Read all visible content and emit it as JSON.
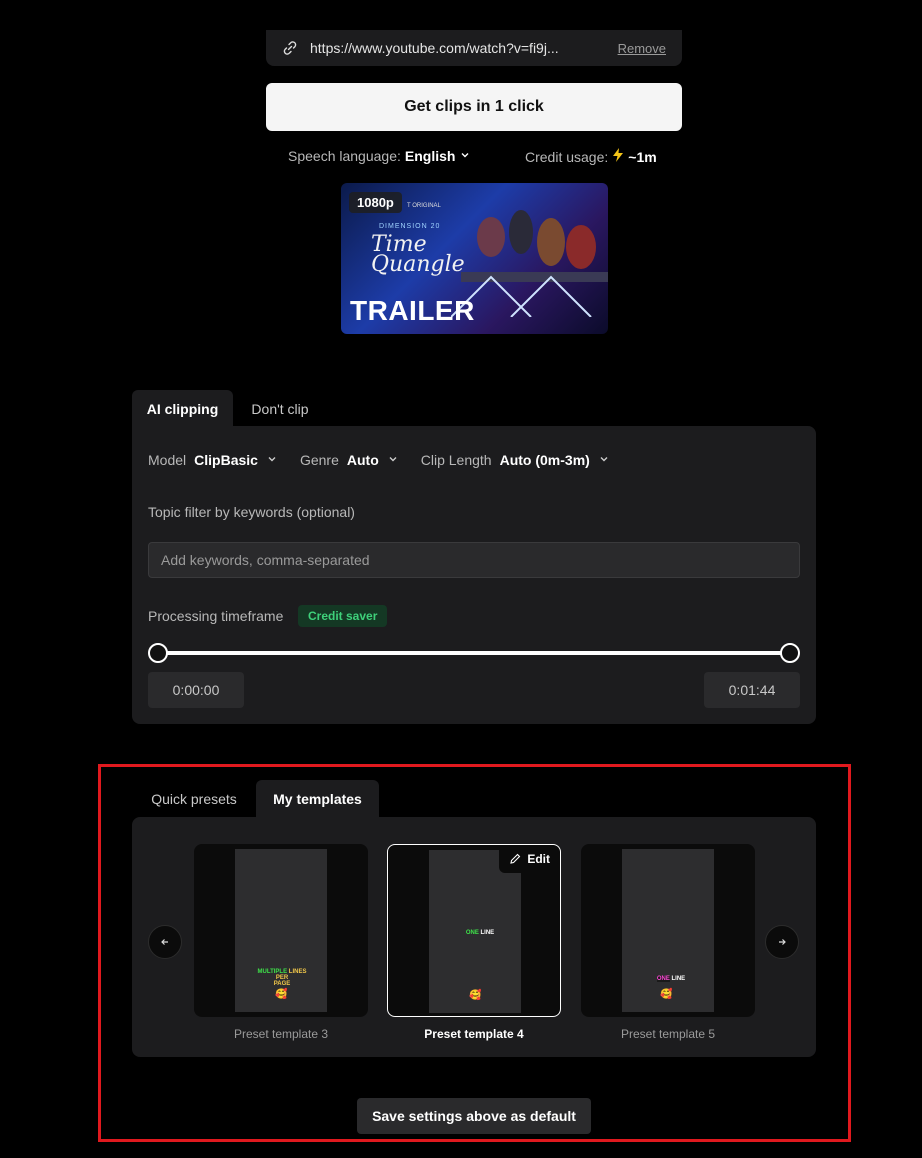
{
  "source": {
    "url": "https://www.youtube.com/watch?v=fi9j...",
    "remove_label": "Remove"
  },
  "cta": {
    "get_clips_label": "Get clips in 1 click"
  },
  "meta": {
    "speech_label": "Speech language:",
    "speech_value": "English",
    "credit_label": "Credit usage:",
    "credit_value": "~1m"
  },
  "video": {
    "resolution_badge": "1080p",
    "thumb_small_original": "T ORIGINAL",
    "thumb_dimension": "DIMENSION 20",
    "thumb_title_line1": "Time",
    "thumb_title_line2": "Quangle",
    "thumb_trailer": "TRAILER"
  },
  "clip_tabs": [
    {
      "label": "AI clipping",
      "active": true
    },
    {
      "label": "Don't clip",
      "active": false
    }
  ],
  "options": {
    "model_label": "Model",
    "model_value": "ClipBasic",
    "genre_label": "Genre",
    "genre_value": "Auto",
    "length_label": "Clip Length",
    "length_value": "Auto (0m-3m)"
  },
  "topic": {
    "label": "Topic filter by keywords (optional)",
    "placeholder": "Add keywords, comma-separated",
    "value": ""
  },
  "timeframe": {
    "label": "Processing timeframe",
    "badge": "Credit saver",
    "start": "0:00:00",
    "end": "0:01:44",
    "range_fraction": [
      0,
      1
    ]
  },
  "template_tabs": [
    {
      "label": "Quick presets",
      "active": false
    },
    {
      "label": "My templates",
      "active": true
    }
  ],
  "templates": [
    {
      "label": "Preset template 3",
      "caption_a": "MULTIPLE",
      "caption_b": "LINES PER",
      "caption_c": "PAGE",
      "emoji": "🥰"
    },
    {
      "label": "Preset template 4",
      "caption_a": "ONE",
      "caption_b": "LINE",
      "emoji": "🥰",
      "selected": true,
      "edit_label": "Edit"
    },
    {
      "label": "Preset template 5",
      "caption_a": "ONE",
      "caption_b": "LINE",
      "emoji": "🥰"
    }
  ],
  "save_default_label": "Save settings above as default",
  "colors": {
    "highlight": "#e0191e",
    "credit_saver": "#3ed07a",
    "bolt": "#f5c518"
  }
}
